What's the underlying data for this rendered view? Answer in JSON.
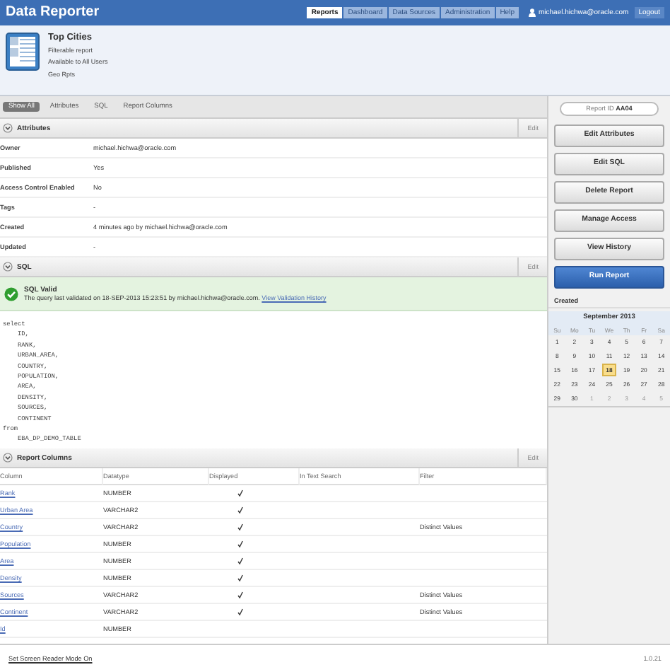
{
  "header": {
    "title": "Data Reporter",
    "nav": [
      {
        "label": "Reports",
        "selected": true
      },
      {
        "label": "Dashboard",
        "selected": false
      },
      {
        "label": "Data Sources",
        "selected": false
      },
      {
        "label": "Administration",
        "selected": false
      },
      {
        "label": "Help",
        "selected": false
      }
    ],
    "user": "michael.hichwa@oracle.com",
    "logout": "Logout"
  },
  "report": {
    "title": "Top Cities",
    "lines": [
      "Filterable report",
      "Available to All Users",
      "Geo Rpts"
    ]
  },
  "section_tabs": [
    {
      "label": "Show All",
      "selected": true
    },
    {
      "label": "Attributes",
      "selected": false
    },
    {
      "label": "SQL",
      "selected": false
    },
    {
      "label": "Report Columns",
      "selected": false
    }
  ],
  "attributes": {
    "title": "Attributes",
    "edit": "Edit",
    "rows": [
      {
        "label": "Owner",
        "value": "michael.hichwa@oracle.com"
      },
      {
        "label": "Published",
        "value": "Yes"
      },
      {
        "label": "Access Control Enabled",
        "value": "No"
      },
      {
        "label": "Tags",
        "value": "-"
      },
      {
        "label": "Created",
        "value": "4 minutes ago by michael.hichwa@oracle.com"
      },
      {
        "label": "Updated",
        "value": "-"
      }
    ]
  },
  "sql": {
    "title": "SQL",
    "edit": "Edit",
    "status_title": "SQL Valid",
    "status_text": "The query last validated on 18-SEP-2013 15:23:51 by michael.hichwa@oracle.com.",
    "status_link": "View Validation History",
    "code": "select\n    ID,\n    RANK,\n    URBAN_AREA,\n    COUNTRY,\n    POPULATION,\n    AREA,\n    DENSITY,\n    SOURCES,\n    CONTINENT\nfrom\n    EBA_DP_DEMO_TABLE"
  },
  "report_columns": {
    "title": "Report Columns",
    "edit": "Edit",
    "columns": [
      "Column",
      "Datatype",
      "Displayed",
      "In Text Search",
      "Filter"
    ],
    "rows": [
      {
        "column": "Rank",
        "datatype": "NUMBER",
        "displayed": true
      },
      {
        "column": "Urban Area",
        "datatype": "VARCHAR2",
        "displayed": true
      },
      {
        "column": "Country",
        "datatype": "VARCHAR2",
        "displayed": true,
        "filter": "Distinct Values"
      },
      {
        "column": "Population",
        "datatype": "NUMBER",
        "displayed": true
      },
      {
        "column": "Area",
        "datatype": "NUMBER",
        "displayed": true
      },
      {
        "column": "Density",
        "datatype": "NUMBER",
        "displayed": true
      },
      {
        "column": "Sources",
        "datatype": "VARCHAR2",
        "displayed": true,
        "filter": "Distinct Values"
      },
      {
        "column": "Continent",
        "datatype": "VARCHAR2",
        "displayed": true,
        "filter": "Distinct Values"
      },
      {
        "column": "Id",
        "datatype": "NUMBER",
        "displayed": false
      }
    ]
  },
  "sidebar": {
    "report_id_label": "Report ID",
    "report_id": "AA04",
    "buttons": [
      {
        "label": "Edit Attributes",
        "kind": "default"
      },
      {
        "label": "Edit SQL",
        "kind": "default"
      },
      {
        "label": "Delete Report",
        "kind": "default"
      },
      {
        "label": "Manage Access",
        "kind": "default"
      },
      {
        "label": "View History",
        "kind": "default"
      },
      {
        "label": "Run Report",
        "kind": "primary"
      }
    ],
    "created_label": "Created",
    "calendar": {
      "month": "September 2013",
      "weekdays": [
        "Su",
        "Mo",
        "Tu",
        "We",
        "Th",
        "Fr",
        "Sa"
      ],
      "weeks": [
        [
          {
            "day": "1",
            "outside": false,
            "selected": false
          },
          {
            "day": "2",
            "outside": false,
            "selected": false
          },
          {
            "day": "3",
            "outside": false,
            "selected": false
          },
          {
            "day": "4",
            "outside": false,
            "selected": false
          },
          {
            "day": "5",
            "outside": false,
            "selected": false
          },
          {
            "day": "6",
            "outside": false,
            "selected": false
          },
          {
            "day": "7",
            "outside": false,
            "selected": false
          }
        ],
        [
          {
            "day": "8",
            "outside": false,
            "selected": false
          },
          {
            "day": "9",
            "outside": false,
            "selected": false
          },
          {
            "day": "10",
            "outside": false,
            "selected": false
          },
          {
            "day": "11",
            "outside": false,
            "selected": false
          },
          {
            "day": "12",
            "outside": false,
            "selected": false
          },
          {
            "day": "13",
            "outside": false,
            "selected": false
          },
          {
            "day": "14",
            "outside": false,
            "selected": false
          }
        ],
        [
          {
            "day": "15",
            "outside": false,
            "selected": false
          },
          {
            "day": "16",
            "outside": false,
            "selected": false
          },
          {
            "day": "17",
            "outside": false,
            "selected": false
          },
          {
            "day": "18",
            "outside": false,
            "selected": true
          },
          {
            "day": "19",
            "outside": false,
            "selected": false
          },
          {
            "day": "20",
            "outside": false,
            "selected": false
          },
          {
            "day": "21",
            "outside": false,
            "selected": false
          }
        ],
        [
          {
            "day": "22",
            "outside": false,
            "selected": false
          },
          {
            "day": "23",
            "outside": false,
            "selected": false
          },
          {
            "day": "24",
            "outside": false,
            "selected": false
          },
          {
            "day": "25",
            "outside": false,
            "selected": false
          },
          {
            "day": "26",
            "outside": false,
            "selected": false
          },
          {
            "day": "27",
            "outside": false,
            "selected": false
          },
          {
            "day": "28",
            "outside": false,
            "selected": false
          }
        ],
        [
          {
            "day": "29",
            "outside": false,
            "selected": false
          },
          {
            "day": "30",
            "outside": false,
            "selected": false
          },
          {
            "day": "1",
            "outside": true,
            "selected": false
          },
          {
            "day": "2",
            "outside": true,
            "selected": false
          },
          {
            "day": "3",
            "outside": true,
            "selected": false
          },
          {
            "day": "4",
            "outside": true,
            "selected": false
          },
          {
            "day": "5",
            "outside": true,
            "selected": false
          }
        ]
      ]
    }
  },
  "footer": {
    "link": "Set Screen Reader Mode On",
    "version": "1.0.21"
  }
}
